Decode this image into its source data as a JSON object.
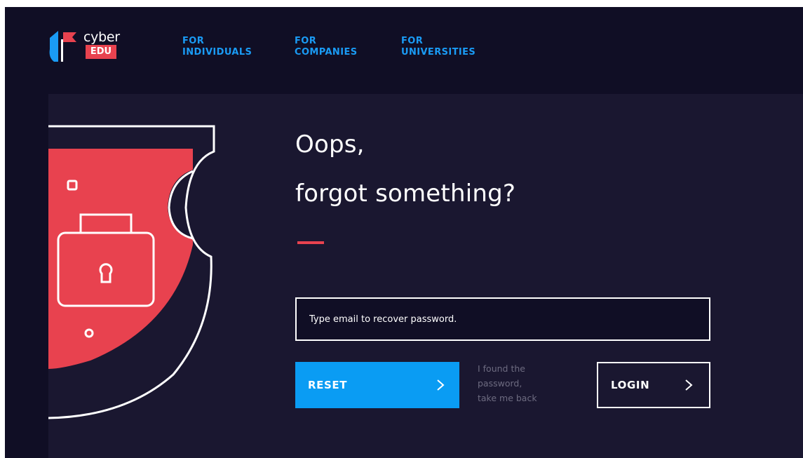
{
  "brand": {
    "logo_primary": "cyber",
    "logo_secondary": "EDU",
    "colors": {
      "accent_red": "#e8424f",
      "accent_blue": "#0a9cf3",
      "nav_blue": "#1a9bf5",
      "background": "#100e25",
      "panel": "#1a1730"
    }
  },
  "nav": {
    "items": [
      {
        "line1": "FOR",
        "line2": "INDIVIDUALS"
      },
      {
        "line1": "FOR",
        "line2": "COMPANIES"
      },
      {
        "line1": "FOR",
        "line2": "UNIVERSITIES"
      }
    ]
  },
  "main": {
    "heading_line1": "Oops,",
    "heading_line2": "forgot something?",
    "illustration_icon": "shield-lock-icon",
    "email": {
      "placeholder": "Type email to recover password.",
      "value": ""
    },
    "reset_label": "RESET",
    "found_line1": "I found the",
    "found_line2": "password,",
    "found_line3": "take me back",
    "login_label": "LOGIN",
    "arrow_icon": "chevron-right-icon"
  }
}
